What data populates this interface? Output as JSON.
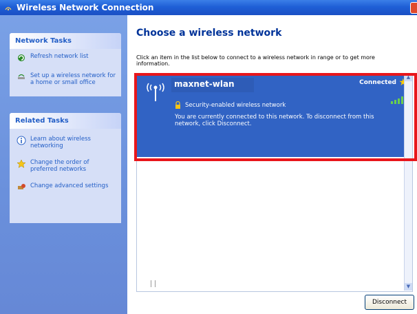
{
  "window": {
    "title": "Wireless Network Connection"
  },
  "network_tasks": {
    "header": "Network Tasks",
    "items": [
      {
        "label": "Refresh network list",
        "icon": "refresh-icon"
      },
      {
        "label": "Set up a wireless network for a home or small office",
        "icon": "setup-wireless-icon"
      }
    ]
  },
  "related_tasks": {
    "header": "Related Tasks",
    "items": [
      {
        "label": "Learn about wireless networking",
        "icon": "info-icon"
      },
      {
        "label": "Change the order of preferred networks",
        "icon": "star-icon"
      },
      {
        "label": "Change advanced settings",
        "icon": "settings-icon"
      }
    ]
  },
  "main": {
    "title": "Choose a wireless network",
    "instruction": "Click an item in the list below to connect to a wireless network in range or to get more information.",
    "network": {
      "name": "maxnet-wlan",
      "status": "Connected",
      "security": "Security-enabled wireless network",
      "description": "You are currently connected to this network. To disconnect from this network, click Disconnect."
    },
    "disconnect_label": "Disconnect"
  },
  "colors": {
    "accent": "#3163c4",
    "highlight_border": "#e8161b",
    "title_blue": "#003399"
  }
}
